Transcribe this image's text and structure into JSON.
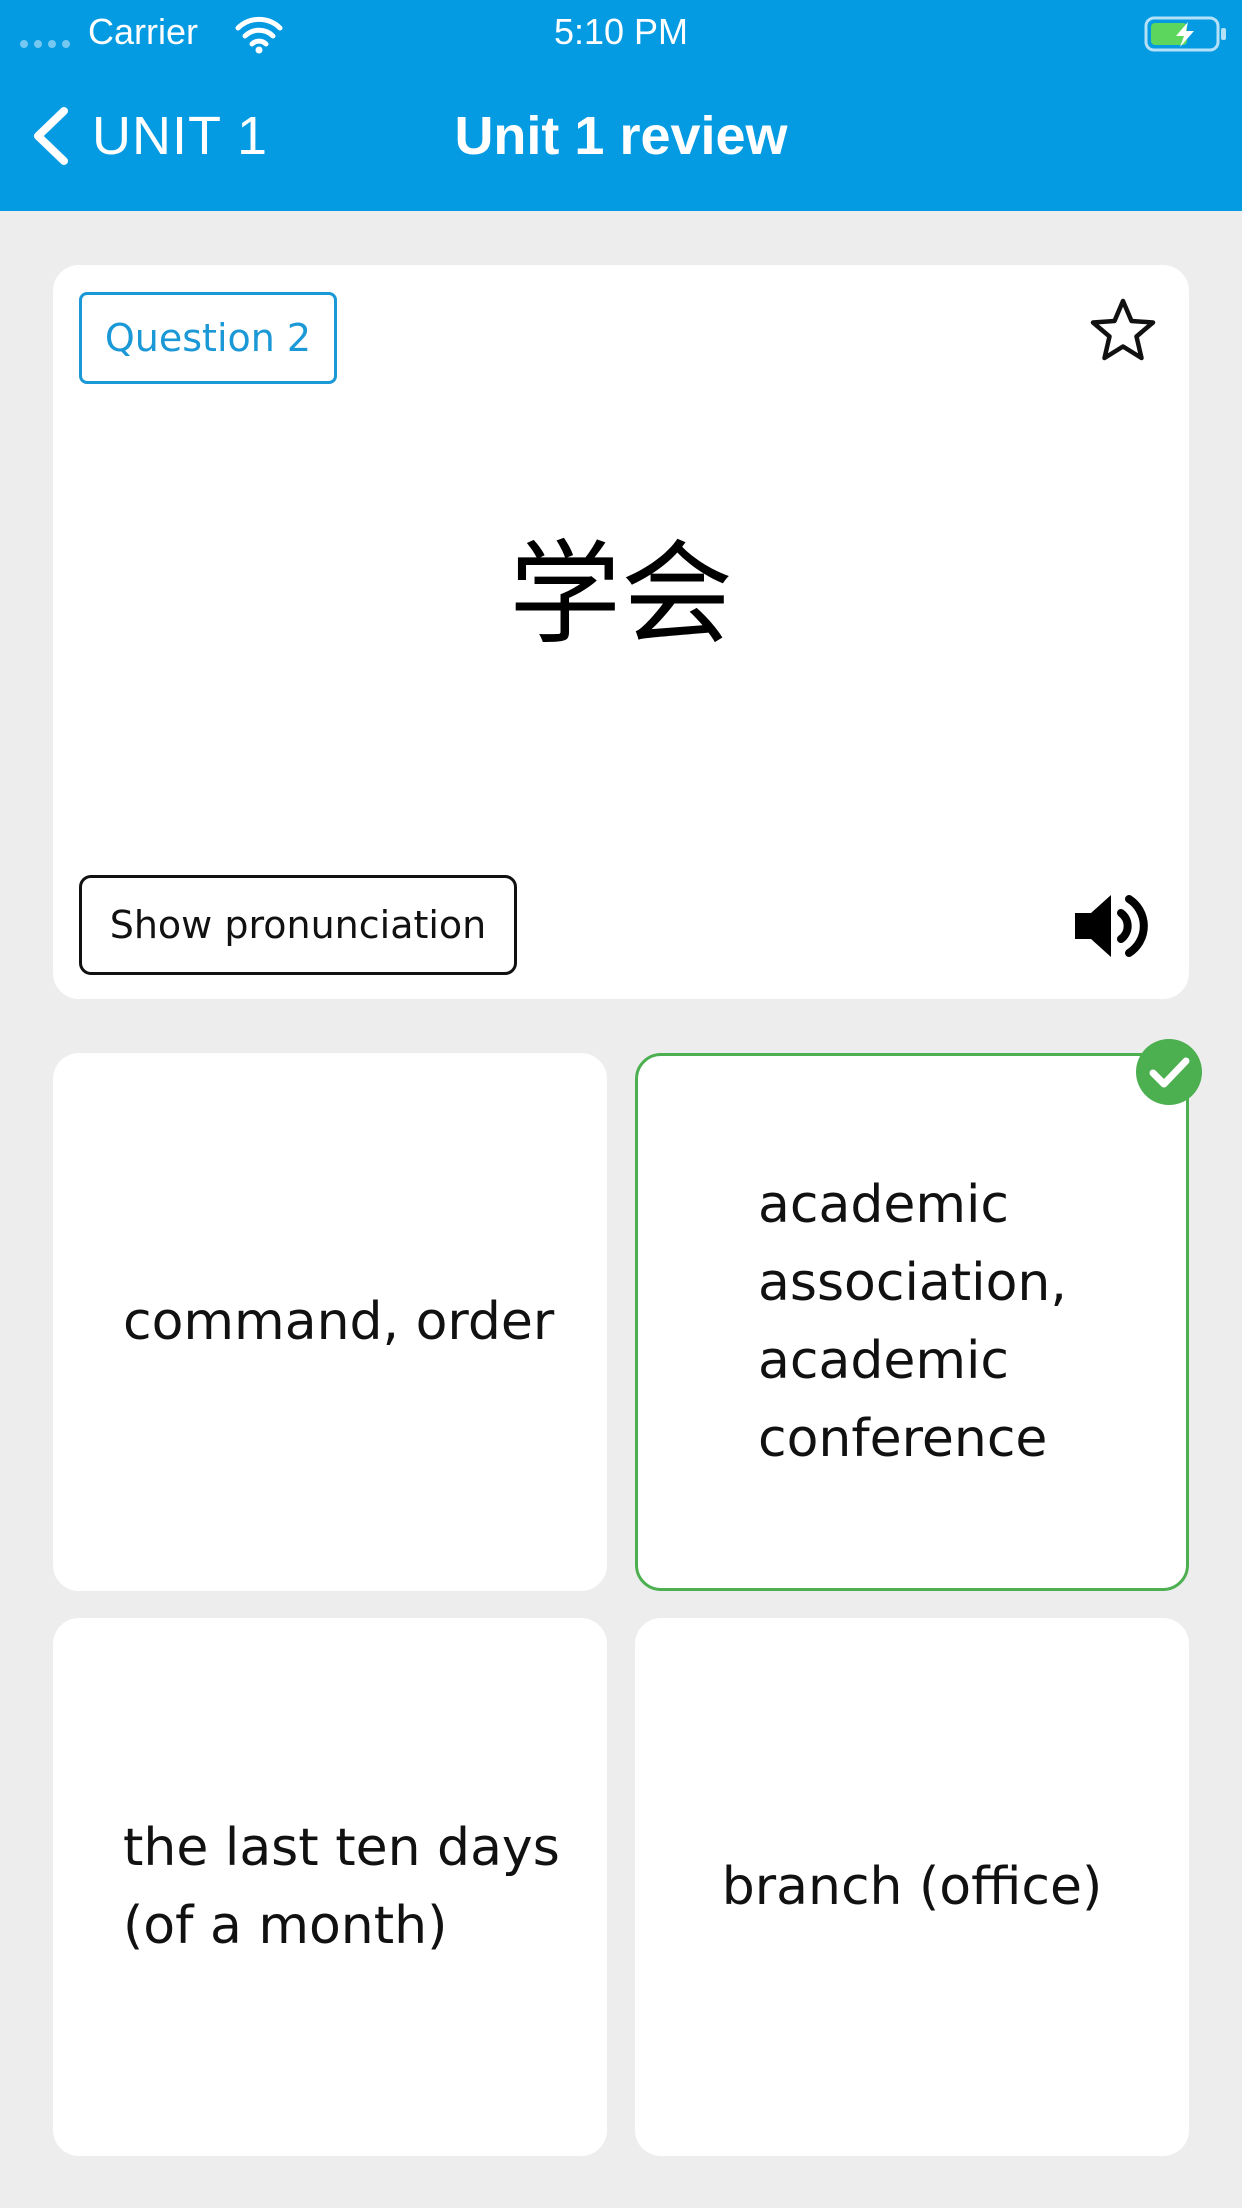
{
  "status_bar": {
    "carrier": "Carrier",
    "time": "5:10 PM",
    "icons": [
      "signal-dots-icon",
      "wifi-icon",
      "battery-charging-icon"
    ]
  },
  "nav": {
    "back_label": "UNIT 1",
    "title": "Unit 1 review"
  },
  "question": {
    "badge": "Question 2",
    "term": "学会",
    "show_pronunciation_label": "Show pronunciation",
    "icons": [
      "star-icon",
      "speaker-icon"
    ]
  },
  "answers": [
    {
      "text": "command, order",
      "selected": false
    },
    {
      "text": "academic association, academic conference",
      "selected": true
    },
    {
      "text": "the last ten days (of a month)",
      "selected": false
    },
    {
      "text": "branch (office)",
      "selected": false
    }
  ],
  "colors": {
    "header": "#059be3",
    "accent": "#1b98d6",
    "correct": "#4caf50",
    "background": "#ededed"
  }
}
